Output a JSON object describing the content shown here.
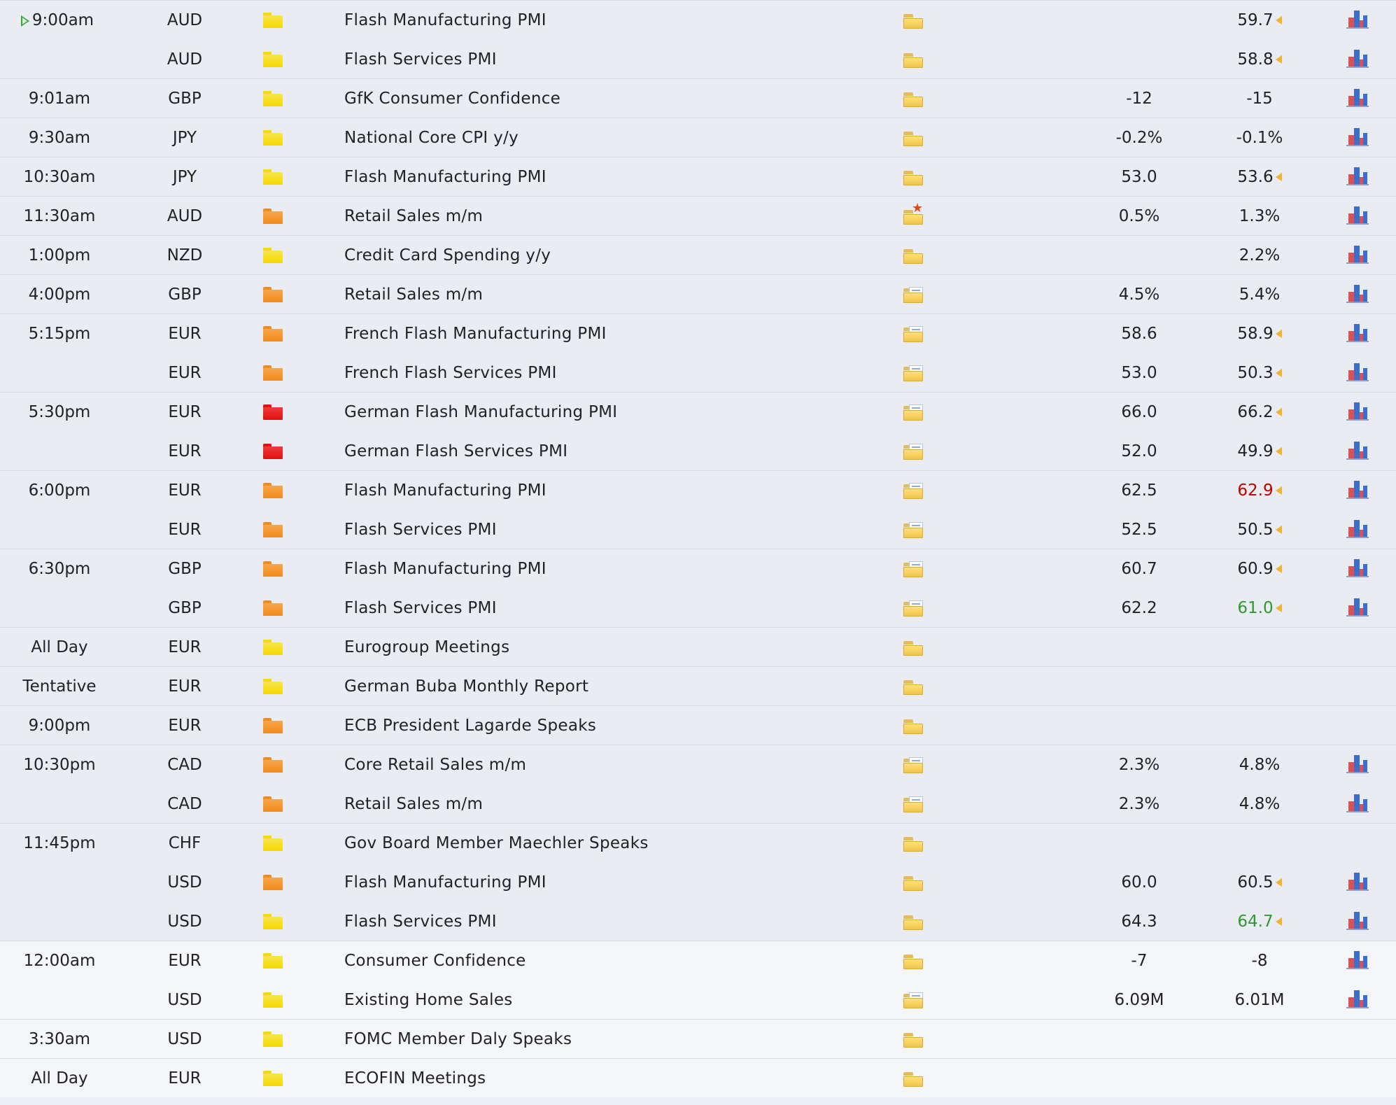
{
  "colors": {
    "impact_low": "#f5d800",
    "impact_medium": "#f08a1c",
    "impact_high": "#e01010",
    "revised_up": "#2e9a2e",
    "revised_down": "#c00000",
    "now_marker": "#3aa33a"
  },
  "rows": [
    {
      "time": "9:00am",
      "currency": "AUD",
      "impact": "low",
      "event": "Flash Manufacturing PMI",
      "detail": "folder",
      "forecast": "",
      "previous": "59.7",
      "revised": true,
      "graph": true,
      "now": true,
      "group_start": true
    },
    {
      "time": "",
      "currency": "AUD",
      "impact": "low",
      "event": "Flash Services PMI",
      "detail": "folder",
      "forecast": "",
      "previous": "58.8",
      "revised": true,
      "graph": true
    },
    {
      "time": "9:01am",
      "currency": "GBP",
      "impact": "low",
      "event": "GfK Consumer Confidence",
      "detail": "folder",
      "forecast": "-12",
      "previous": "-15",
      "graph": true,
      "group_start": true
    },
    {
      "time": "9:30am",
      "currency": "JPY",
      "impact": "low",
      "event": "National Core CPI y/y",
      "detail": "folder",
      "forecast": "-0.2%",
      "previous": "-0.1%",
      "graph": true,
      "group_start": true
    },
    {
      "time": "10:30am",
      "currency": "JPY",
      "impact": "low",
      "event": "Flash Manufacturing PMI",
      "detail": "folder",
      "forecast": "53.0",
      "previous": "53.6",
      "revised": true,
      "graph": true,
      "group_start": true
    },
    {
      "time": "11:30am",
      "currency": "AUD",
      "impact": "medium",
      "event": "Retail Sales m/m",
      "detail": "star",
      "forecast": "0.5%",
      "previous": "1.3%",
      "graph": true,
      "group_start": true
    },
    {
      "time": "1:00pm",
      "currency": "NZD",
      "impact": "low",
      "event": "Credit Card Spending y/y",
      "detail": "folder",
      "forecast": "",
      "previous": "2.2%",
      "graph": true,
      "group_start": true
    },
    {
      "time": "4:00pm",
      "currency": "GBP",
      "impact": "medium",
      "event": "Retail Sales m/m",
      "detail": "paper",
      "forecast": "4.5%",
      "previous": "5.4%",
      "graph": true,
      "group_start": true
    },
    {
      "time": "5:15pm",
      "currency": "EUR",
      "impact": "medium",
      "event": "French Flash Manufacturing PMI",
      "detail": "paper",
      "forecast": "58.6",
      "previous": "58.9",
      "revised": true,
      "graph": true,
      "group_start": true
    },
    {
      "time": "",
      "currency": "EUR",
      "impact": "medium",
      "event": "French Flash Services PMI",
      "detail": "paper",
      "forecast": "53.0",
      "previous": "50.3",
      "revised": true,
      "graph": true
    },
    {
      "time": "5:30pm",
      "currency": "EUR",
      "impact": "high",
      "event": "German Flash Manufacturing PMI",
      "detail": "paper",
      "forecast": "66.0",
      "previous": "66.2",
      "revised": true,
      "graph": true,
      "group_start": true
    },
    {
      "time": "",
      "currency": "EUR",
      "impact": "high",
      "event": "German Flash Services PMI",
      "detail": "paper",
      "forecast": "52.0",
      "previous": "49.9",
      "revised": true,
      "graph": true
    },
    {
      "time": "6:00pm",
      "currency": "EUR",
      "impact": "medium",
      "event": "Flash Manufacturing PMI",
      "detail": "paper",
      "forecast": "62.5",
      "previous": "62.9",
      "previous_color": "red",
      "revised": true,
      "graph": true,
      "group_start": true
    },
    {
      "time": "",
      "currency": "EUR",
      "impact": "medium",
      "event": "Flash Services PMI",
      "detail": "paper",
      "forecast": "52.5",
      "previous": "50.5",
      "revised": true,
      "graph": true
    },
    {
      "time": "6:30pm",
      "currency": "GBP",
      "impact": "medium",
      "event": "Flash Manufacturing PMI",
      "detail": "paper",
      "forecast": "60.7",
      "previous": "60.9",
      "revised": true,
      "graph": true,
      "group_start": true
    },
    {
      "time": "",
      "currency": "GBP",
      "impact": "medium",
      "event": "Flash Services PMI",
      "detail": "paper",
      "forecast": "62.2",
      "previous": "61.0",
      "previous_color": "green",
      "revised": true,
      "graph": true
    },
    {
      "time": "All Day",
      "currency": "EUR",
      "impact": "low",
      "event": "Eurogroup Meetings",
      "detail": "folder",
      "forecast": "",
      "previous": "",
      "graph": false,
      "group_start": true
    },
    {
      "time": "Tentative",
      "currency": "EUR",
      "impact": "low",
      "event": "German Buba Monthly Report",
      "detail": "folder",
      "forecast": "",
      "previous": "",
      "graph": false,
      "group_start": true
    },
    {
      "time": "9:00pm",
      "currency": "EUR",
      "impact": "medium",
      "event": "ECB President Lagarde Speaks",
      "detail": "folder",
      "forecast": "",
      "previous": "",
      "graph": false,
      "group_start": true
    },
    {
      "time": "10:30pm",
      "currency": "CAD",
      "impact": "medium",
      "event": "Core Retail Sales m/m",
      "detail": "paper",
      "forecast": "2.3%",
      "previous": "4.8%",
      "graph": true,
      "group_start": true
    },
    {
      "time": "",
      "currency": "CAD",
      "impact": "medium",
      "event": "Retail Sales m/m",
      "detail": "paper",
      "forecast": "2.3%",
      "previous": "4.8%",
      "graph": true
    },
    {
      "time": "11:45pm",
      "currency": "CHF",
      "impact": "low",
      "event": "Gov Board Member Maechler Speaks",
      "detail": "folder",
      "forecast": "",
      "previous": "",
      "graph": false,
      "group_start": true
    },
    {
      "time": "",
      "currency": "USD",
      "impact": "medium",
      "event": "Flash Manufacturing PMI",
      "detail": "folder",
      "forecast": "60.0",
      "previous": "60.5",
      "revised": true,
      "graph": true
    },
    {
      "time": "",
      "currency": "USD",
      "impact": "low",
      "event": "Flash Services PMI",
      "detail": "folder",
      "forecast": "64.3",
      "previous": "64.7",
      "previous_color": "green",
      "revised": true,
      "graph": true
    },
    {
      "time": "12:00am",
      "currency": "EUR",
      "impact": "low",
      "event": "Consumer Confidence",
      "detail": "folder",
      "forecast": "-7",
      "previous": "-8",
      "graph": true,
      "group_start": true,
      "light": true
    },
    {
      "time": "",
      "currency": "USD",
      "impact": "low",
      "event": "Existing Home Sales",
      "detail": "paper",
      "forecast": "6.09M",
      "previous": "6.01M",
      "graph": true,
      "light": true
    },
    {
      "time": "3:30am",
      "currency": "USD",
      "impact": "low",
      "event": "FOMC Member Daly Speaks",
      "detail": "folder",
      "forecast": "",
      "previous": "",
      "graph": false,
      "group_start": true,
      "light": true
    },
    {
      "time": "All Day",
      "currency": "EUR",
      "impact": "low",
      "event": "ECOFIN Meetings",
      "detail": "folder",
      "forecast": "",
      "previous": "",
      "graph": false,
      "group_start": true,
      "light": true
    }
  ]
}
